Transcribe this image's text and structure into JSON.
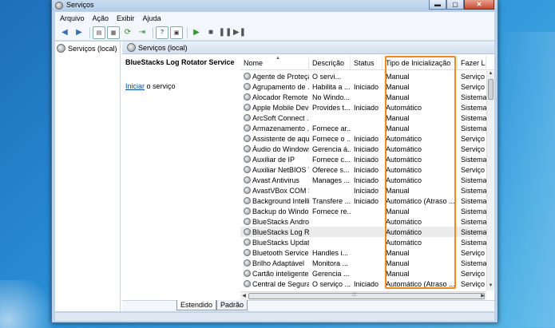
{
  "window": {
    "title": "Serviços",
    "controls": {
      "minimize": "▬",
      "maximize": "▢",
      "close": "✕"
    }
  },
  "menu": [
    "Arquivo",
    "Ação",
    "Exibir",
    "Ajuda"
  ],
  "tree": {
    "root": "Serviços (local)"
  },
  "panel": {
    "header": "Serviços (local)"
  },
  "detail": {
    "service_name": "BlueStacks Log Rotator Service",
    "start_link": "Iniciar",
    "start_suffix": " o serviço"
  },
  "columns": {
    "name": "Nome",
    "desc": "Descrição",
    "status": "Status",
    "tipo": "Tipo de Inicialização",
    "fazer": "Fazer Lo"
  },
  "services": [
    {
      "name": "Agente de Proteçã...",
      "desc": "O servi...",
      "status": "",
      "tipo": "Manual",
      "fazer": "Serviço"
    },
    {
      "name": "Agrupamento de ...",
      "desc": "Habilita a ...",
      "status": "Iniciado",
      "tipo": "Manual",
      "fazer": "Serviço"
    },
    {
      "name": "Alocador Remote ...",
      "desc": "No Windo...",
      "status": "",
      "tipo": "Manual",
      "fazer": "Sistema"
    },
    {
      "name": "Apple Mobile Devi...",
      "desc": "Provides t...",
      "status": "Iniciado",
      "tipo": "Automático",
      "fazer": "Sistema"
    },
    {
      "name": "ArcSoft Connect ...",
      "desc": "",
      "status": "",
      "tipo": "Manual",
      "fazer": "Sistema"
    },
    {
      "name": "Armazenamento ...",
      "desc": "Fornece ar...",
      "status": "",
      "tipo": "Manual",
      "fazer": "Sistema"
    },
    {
      "name": "Assistente de aqui...",
      "desc": "Fornece o ...",
      "status": "Iniciado",
      "tipo": "Automático",
      "fazer": "Serviço"
    },
    {
      "name": "Áudio do Windows",
      "desc": "Gerencia á...",
      "status": "Iniciado",
      "tipo": "Automático",
      "fazer": "Serviço"
    },
    {
      "name": "Auxiliar de IP",
      "desc": "Fornece c...",
      "status": "Iniciado",
      "tipo": "Automático",
      "fazer": "Sistema"
    },
    {
      "name": "Auxiliar NetBIOS T...",
      "desc": "Oferece s...",
      "status": "Iniciado",
      "tipo": "Automático",
      "fazer": "Serviço"
    },
    {
      "name": "Avast Antivirus",
      "desc": "Manages ...",
      "status": "Iniciado",
      "tipo": "Automático",
      "fazer": "Sistema"
    },
    {
      "name": "AvastVBox COM S...",
      "desc": "",
      "status": "Iniciado",
      "tipo": "Manual",
      "fazer": "Sistema"
    },
    {
      "name": "Background Intelli...",
      "desc": "Transfere ...",
      "status": "Iniciado",
      "tipo": "Automático (Atraso ...",
      "fazer": "Sistema"
    },
    {
      "name": "Backup do Windo...",
      "desc": "Fornece re...",
      "status": "",
      "tipo": "Manual",
      "fazer": "Sistema"
    },
    {
      "name": "BlueStacks Androi...",
      "desc": "",
      "status": "",
      "tipo": "Automático",
      "fazer": "Sistema"
    },
    {
      "name": "BlueStacks Log Ro...",
      "desc": "",
      "status": "",
      "tipo": "Automático",
      "fazer": "Sistema"
    },
    {
      "name": "BlueStacks Update...",
      "desc": "",
      "status": "",
      "tipo": "Automático",
      "fazer": "Sistema"
    },
    {
      "name": "Bluetooth Service",
      "desc": "Handles i...",
      "status": "",
      "tipo": "Manual",
      "fazer": "Serviço"
    },
    {
      "name": "Brilho Adaptável",
      "desc": "Monitora ...",
      "status": "",
      "tipo": "Manual",
      "fazer": "Sistema"
    },
    {
      "name": "Cartão inteligente",
      "desc": "Gerencia ...",
      "status": "",
      "tipo": "Manual",
      "fazer": "Serviço"
    },
    {
      "name": "Central de Segura...",
      "desc": "O serviço ...",
      "status": "Iniciado",
      "tipo": "Automático (Atraso ...",
      "fazer": "Serviço"
    }
  ],
  "selected_index": 15,
  "tabs": [
    "Estendido",
    "Padrão"
  ],
  "highlight_color": "#f08a1c"
}
